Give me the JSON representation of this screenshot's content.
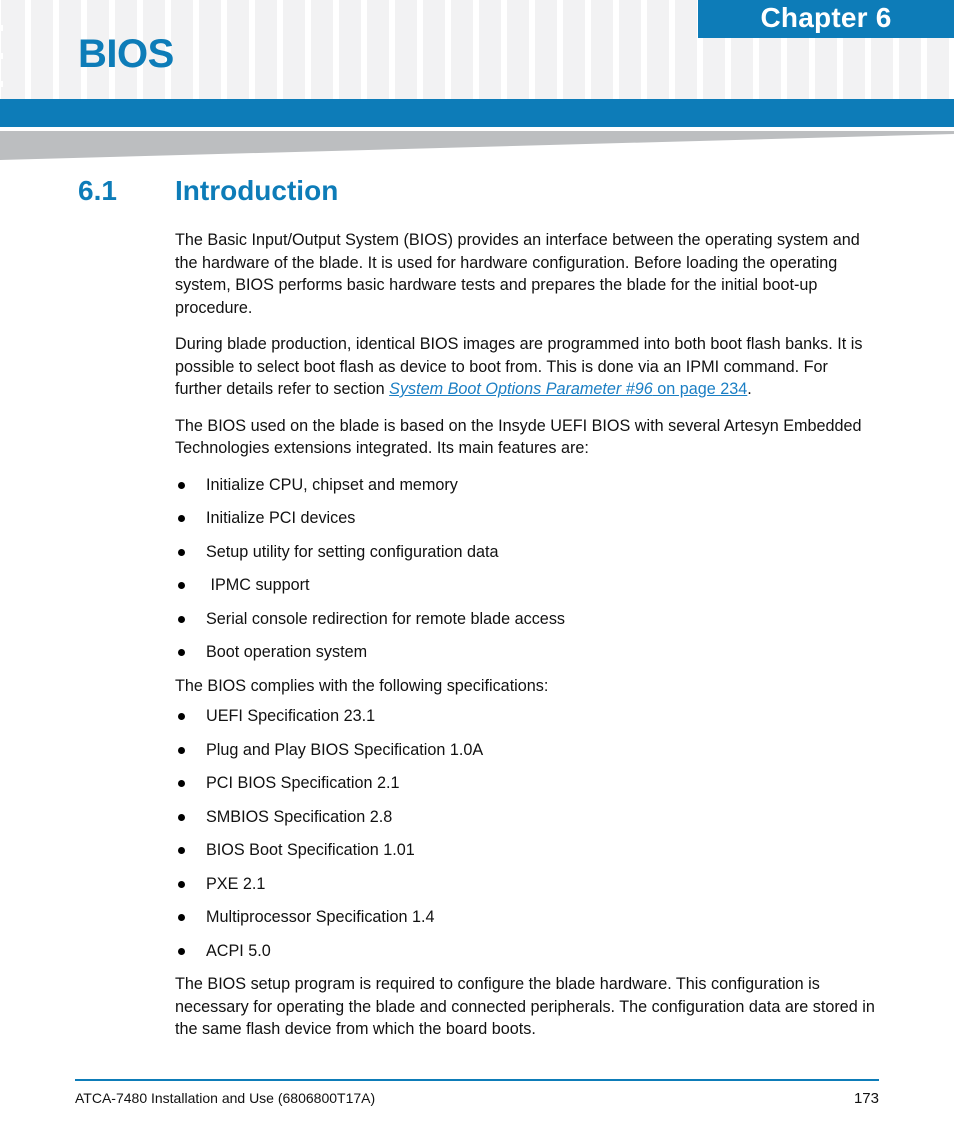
{
  "header": {
    "chapter_label": "Chapter 6",
    "doc_title": "BIOS",
    "accent_color": "#0d7cb8",
    "grid_square_color": "#f2f2f3",
    "wedge_color": "#bcbec0"
  },
  "section": {
    "number": "6.1",
    "title": "Introduction"
  },
  "paragraphs": {
    "intro": "The Basic Input/Output System (BIOS) provides an interface between the operating system and the hardware of the blade. It is used for hardware configuration. Before loading the operating system, BIOS performs basic hardware tests and prepares the blade for the initial boot-up procedure.",
    "flash_banks_lead": "During blade production, identical BIOS images are programmed into both boot flash banks. It is possible to select boot flash as device to boot from. This is done via an IPMI command. For further details refer to section ",
    "flash_banks_link_italic": "System Boot Options Parameter #96",
    "flash_banks_link_plain": " on page 234",
    "flash_banks_tail": ".",
    "insyde": "The BIOS used on the blade is based on the Insyde UEFI BIOS with several Artesyn Embedded Technologies extensions integrated. Its main features are:",
    "specs_lead": "The BIOS complies with the following specifications:",
    "setup_program": "The BIOS setup program is required to configure the blade hardware. This configuration is necessary for operating the blade and connected peripherals. The configuration data are stored in the same flash device from which the board boots."
  },
  "features_list": [
    "Initialize CPU, chipset and memory",
    "Initialize PCI devices",
    "Setup utility for setting configuration data",
    " IPMC support",
    "Serial console redirection for remote blade access",
    "Boot operation system"
  ],
  "specifications_list": [
    "UEFI Specification 23.1",
    "Plug and Play BIOS Specification 1.0A",
    "PCI BIOS Specification 2.1",
    "SMBIOS Specification 2.8",
    "BIOS Boot Specification 1.01",
    "PXE 2.1",
    "Multiprocessor Specification 1.4",
    "ACPI 5.0"
  ],
  "footer": {
    "document_id": "ATCA-7480 Installation and Use (6806800T17A)",
    "page_number": "173"
  }
}
